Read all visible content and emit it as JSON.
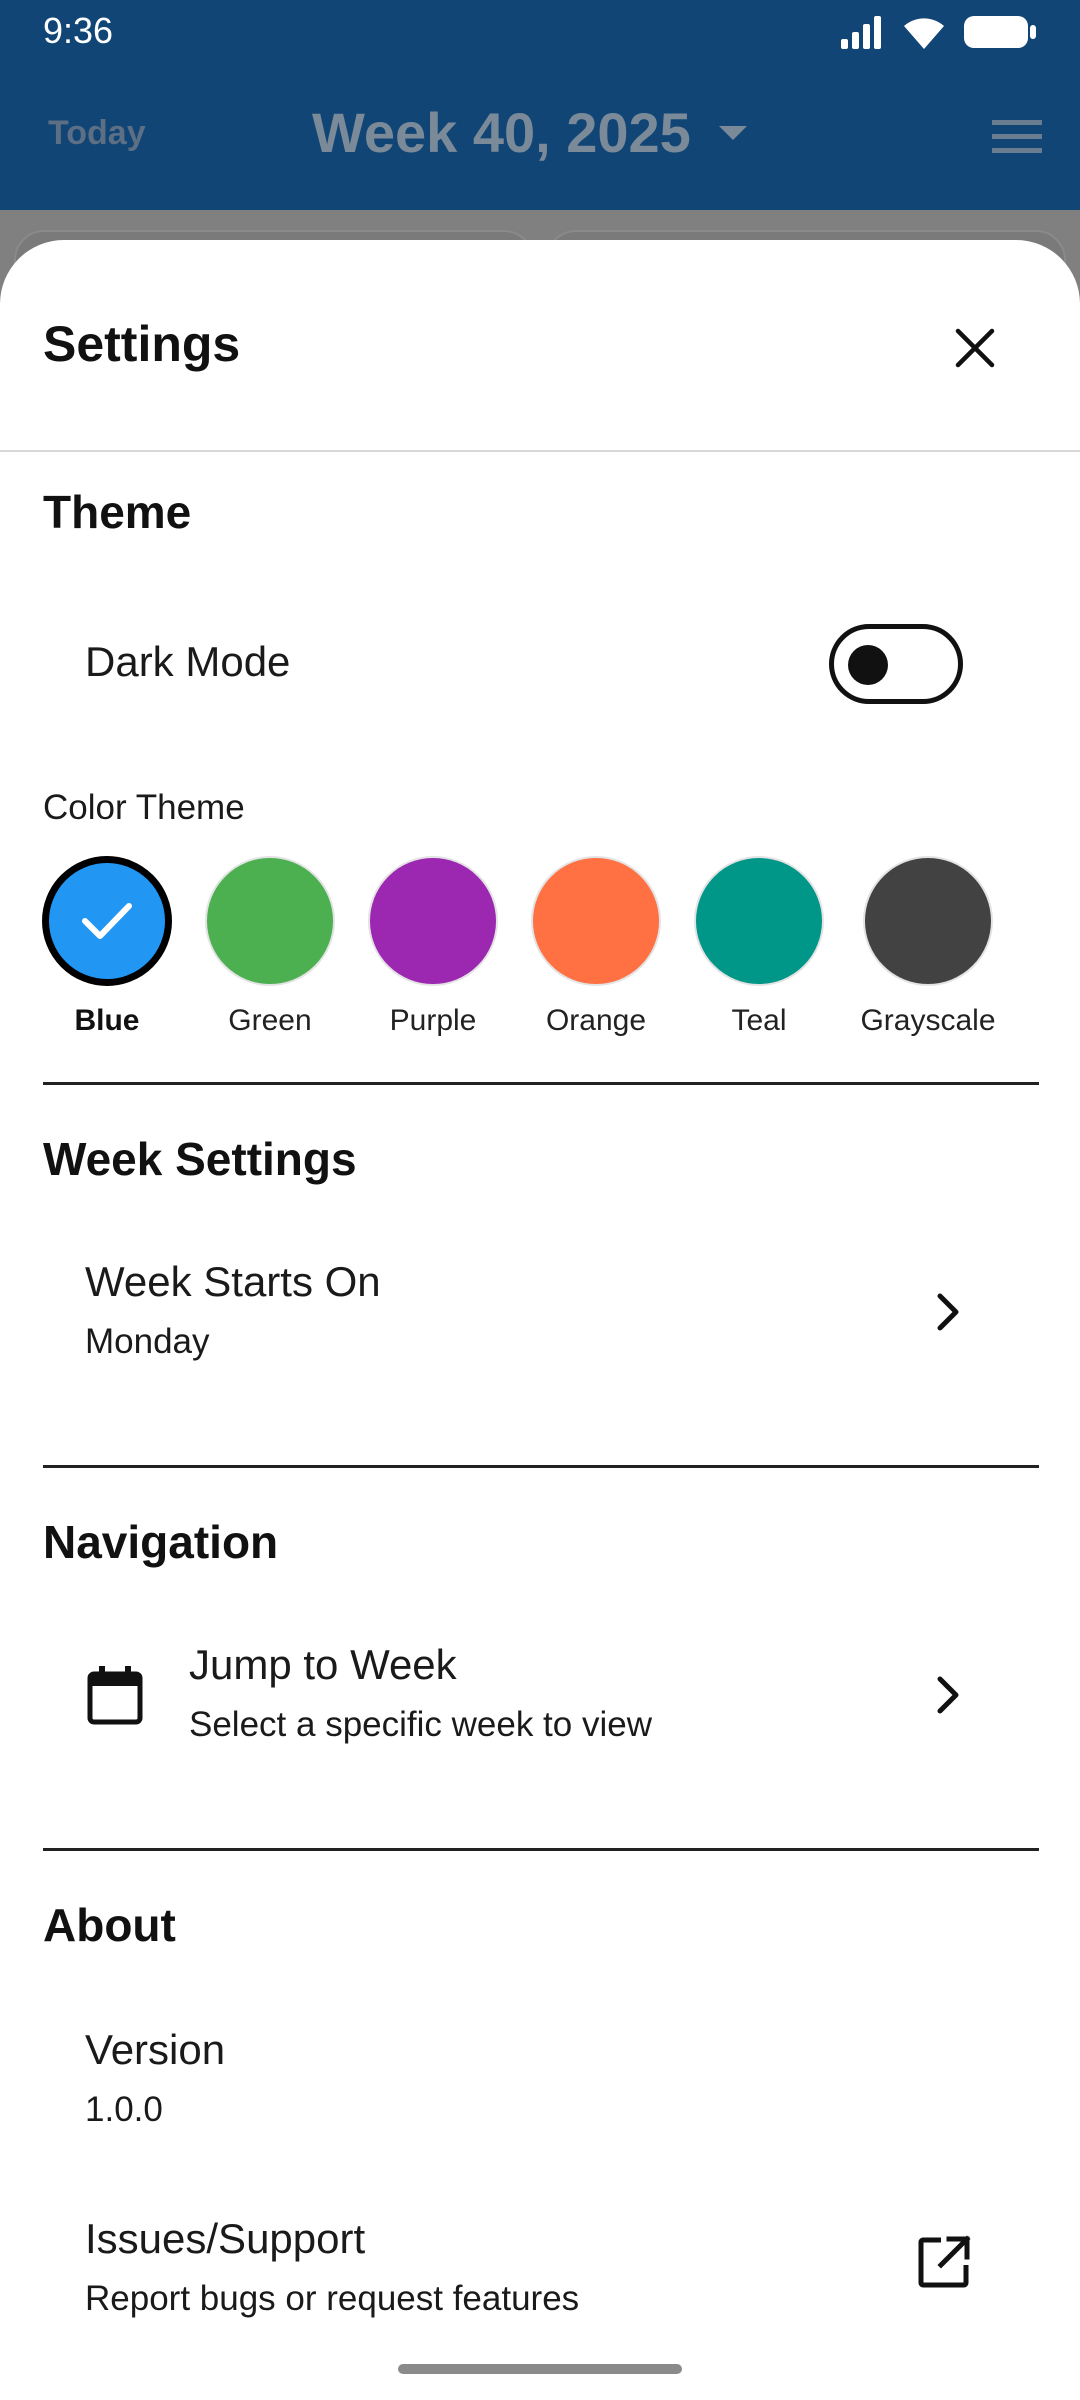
{
  "status_bar": {
    "time": "9:36"
  },
  "app_bar": {
    "today_label": "Today",
    "week_title": "Week 40, 2025"
  },
  "sheet": {
    "title": "Settings",
    "theme": {
      "section_title": "Theme",
      "dark_mode_label": "Dark Mode",
      "dark_mode_on": false,
      "color_theme_label": "Color Theme",
      "colors": [
        {
          "name": "Blue",
          "hex": "#2196F3",
          "selected": true
        },
        {
          "name": "Green",
          "hex": "#4CAF50",
          "selected": false
        },
        {
          "name": "Purple",
          "hex": "#9C27B0",
          "selected": false
        },
        {
          "name": "Orange",
          "hex": "#FF7043",
          "selected": false
        },
        {
          "name": "Teal",
          "hex": "#009688",
          "selected": false
        },
        {
          "name": "Grayscale",
          "hex": "#424242",
          "selected": false
        }
      ]
    },
    "week_settings": {
      "section_title": "Week Settings",
      "week_starts_label": "Week Starts On",
      "week_starts_value": "Monday"
    },
    "navigation": {
      "section_title": "Navigation",
      "jump_label": "Jump to Week",
      "jump_sub": "Select a specific week to view"
    },
    "about": {
      "section_title": "About",
      "version_label": "Version",
      "version_value": "1.0.0",
      "issues_label": "Issues/Support",
      "issues_sub": "Report bugs or request features"
    }
  },
  "icons": {
    "signal": "signal-icon",
    "wifi": "wifi-icon",
    "battery": "battery-icon",
    "dropdown": "arrow-drop-down-icon",
    "menu": "menu-icon",
    "close": "close-icon",
    "check": "check-icon",
    "chevron": "chevron-right-icon",
    "calendar": "calendar-icon",
    "external": "open-in-new-icon"
  },
  "colors": {
    "app_bar": "#104575",
    "scrim": "#808080",
    "sheet": "#FFFFFF"
  }
}
